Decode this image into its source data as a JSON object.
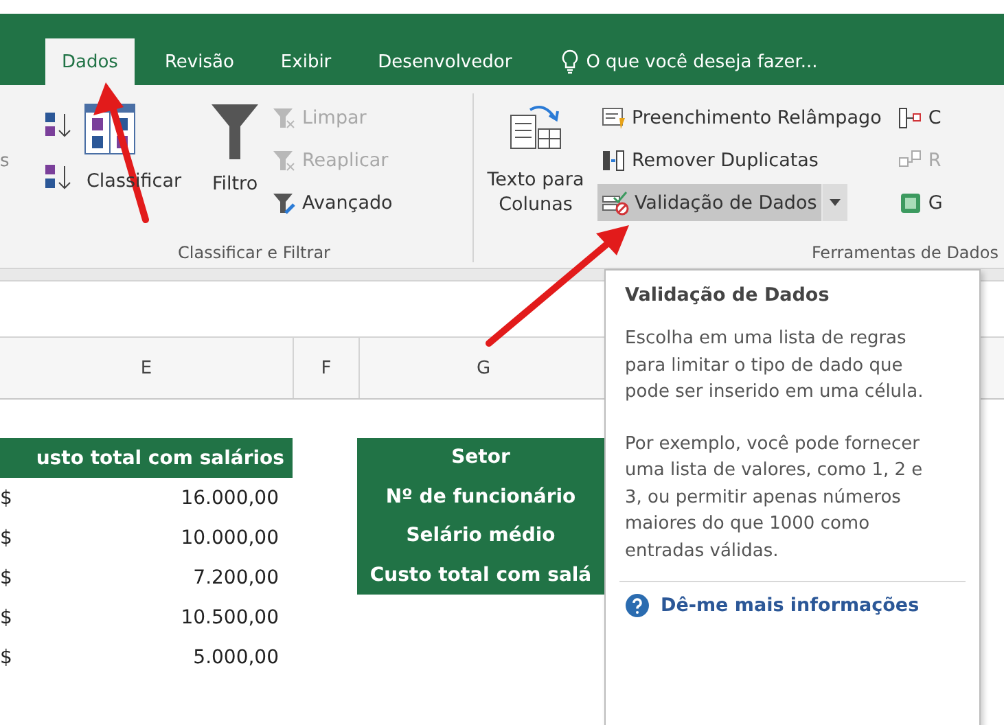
{
  "tabs": [
    {
      "label": "Dados",
      "selected": true
    },
    {
      "label": "Revisão",
      "selected": false
    },
    {
      "label": "Exibir",
      "selected": false
    },
    {
      "label": "Desenvolvedor",
      "selected": false
    }
  ],
  "tell_me": {
    "placeholder": "O que você deseja fazer..."
  },
  "ribbon": {
    "partial_label": "s",
    "sort_filter_group": {
      "label": "Classificar e Filtrar",
      "sort_button": "Classificar",
      "filter_button": "Filtro",
      "small_buttons": [
        {
          "label": "Limpar",
          "disabled": true
        },
        {
          "label": "Reaplicar",
          "disabled": true
        },
        {
          "label": "Avançado",
          "disabled": false
        }
      ]
    },
    "data_tools_group": {
      "label": "Ferramentas de Dados",
      "text_to_columns": "Texto para Colunas",
      "commands": [
        {
          "label": "Preenchimento Relâmpago",
          "kind": "button",
          "hovered": false
        },
        {
          "label": "Remover Duplicatas",
          "kind": "button",
          "hovered": false
        },
        {
          "label": "Validação de Dados",
          "kind": "split",
          "hovered": true
        }
      ],
      "more_commands": [
        {
          "label": "C",
          "disabled": false
        },
        {
          "label": "R",
          "disabled": true
        },
        {
          "label": "G",
          "disabled": false
        }
      ]
    }
  },
  "sheet": {
    "columns": [
      "E",
      "F",
      "G"
    ],
    "table": {
      "header": "usto total com salários",
      "rows": [
        {
          "currency": "$",
          "value": "16.000,00"
        },
        {
          "currency": "$",
          "value": "10.000,00"
        },
        {
          "currency": "$",
          "value": "7.200,00"
        },
        {
          "currency": "$",
          "value": "10.500,00"
        },
        {
          "currency": "$",
          "value": "5.000,00"
        }
      ]
    },
    "summary_labels": [
      "Setor",
      "Nº de funcionário",
      "Selário médio",
      "Custo total com salá"
    ]
  },
  "tooltip": {
    "title": "Validação de Dados",
    "paragraphs": [
      "Escolha em uma lista de regras para limitar o tipo de dado que pode ser inserido em uma célula.",
      "Por exemplo, você pode fornecer uma lista de valores, como 1, 2 e 3, ou permitir apenas números maiores do que 1000 como entradas válidas."
    ],
    "link": "Dê-me mais informações"
  }
}
